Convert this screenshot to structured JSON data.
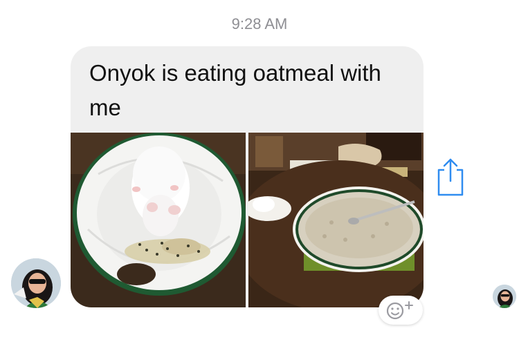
{
  "conversation": {
    "timestamp": "9:28 AM",
    "message": {
      "text": "Onyok is eating oatmeal with me",
      "photos": [
        {
          "subject": "white rat eating oatmeal on a plate"
        },
        {
          "subject": "bowl of oatmeal and plate on a dining table"
        }
      ]
    }
  },
  "icons": {
    "share": "share-icon",
    "reaction": "add-reaction-icon"
  },
  "colors": {
    "bubble": "#efefef",
    "accent": "#2f8cf0",
    "timestamp": "#8e8e93"
  }
}
